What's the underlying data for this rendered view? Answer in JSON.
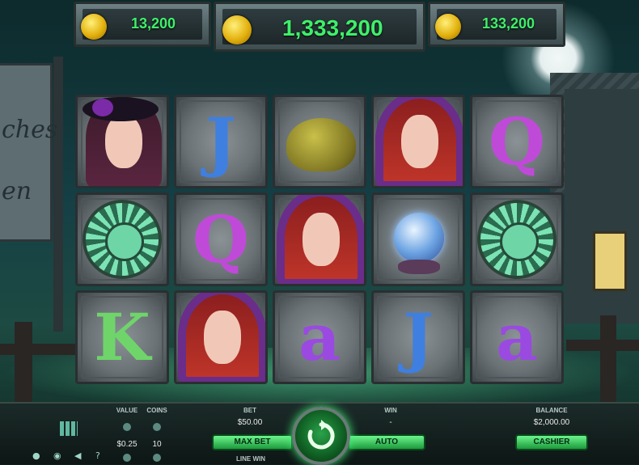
{
  "top_counters": {
    "left": "13,200",
    "center": "1,333,200",
    "right": "133,200"
  },
  "sign_text": [
    "ches",
    "en"
  ],
  "reels": [
    [
      "witch-dark",
      "J",
      "toad",
      "witch-red",
      "Q"
    ],
    [
      "pentacle",
      "Q",
      "witch-red",
      "crystal-ball",
      "pentacle"
    ],
    [
      "K",
      "witch-red",
      "A",
      "J",
      "A"
    ]
  ],
  "reel_letters": {
    "r0c1": "J",
    "r0c4": "Q",
    "r1c1": "Q",
    "r2c0": "K",
    "r2c2": "a",
    "r2c3": "J",
    "r2c4": "a"
  },
  "letter_colors": {
    "J": "#3f7fe0",
    "Q": "#c04ad8",
    "K": "#6fd56a",
    "a": "#9a4ae0"
  },
  "bottom": {
    "value_label": "VALUE",
    "value": "$0.25",
    "coins_label": "COINS",
    "coins": "10",
    "bet_label": "BET",
    "bet": "$50.00",
    "max_bet": "MAX BET",
    "line_win": "LINE WIN",
    "win_label": "WIN",
    "win": "-",
    "auto": "AUTO",
    "balance_label": "BALANCE",
    "balance": "$2,000.00",
    "cashier": "CASHIER"
  }
}
